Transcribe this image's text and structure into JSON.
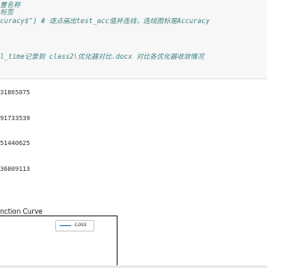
{
  "notebook": {
    "code_cell": {
      "lines": [
        "置名称",
        "标签",
        "curacy$\")  # 逐点画出test_acc值并连线，连线图标是Accuracy",
        "l_time记录到 class2\\优化器对比.docx  对比各优化器收敛情况"
      ]
    },
    "output": {
      "lines": [
        "31865075",
        "91733539",
        "51440625",
        "36009113"
      ]
    },
    "chart": {
      "title": "nction Curve",
      "legend_label": "Loss"
    }
  },
  "colors": {
    "comment": "#408080",
    "string": "#ba2121",
    "series_line": "#1f77b4"
  }
}
